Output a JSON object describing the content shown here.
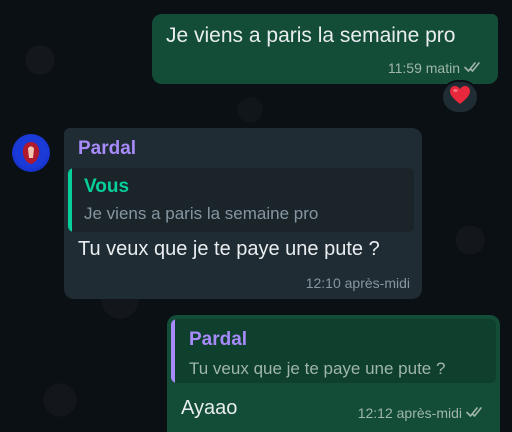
{
  "messages": {
    "out_1": {
      "text": "Je viens a paris la semaine pro",
      "time": "11:59 matin",
      "status_icon": "double-check-icon",
      "reaction": "❤️"
    },
    "in_1": {
      "sender": "Pardal",
      "reply_to": {
        "author": "Vous",
        "text": "Je viens a paris la semaine pro"
      },
      "text": "Tu veux que je te paye une pute ?",
      "time": "12:10 après-midi"
    },
    "out_2": {
      "reply_to": {
        "author": "Pardal",
        "text": "Tu veux que je te paye une pute ?"
      },
      "text": "Ayaao",
      "time": "12:12 après-midi",
      "status_icon": "double-check-icon"
    }
  },
  "colors": {
    "background": "#0b1014",
    "outgoing_bubble": "#134d37",
    "incoming_bubble": "#1f2c33",
    "sender_name": "#a78bfa",
    "own_quote_author": "#06cf9c"
  }
}
